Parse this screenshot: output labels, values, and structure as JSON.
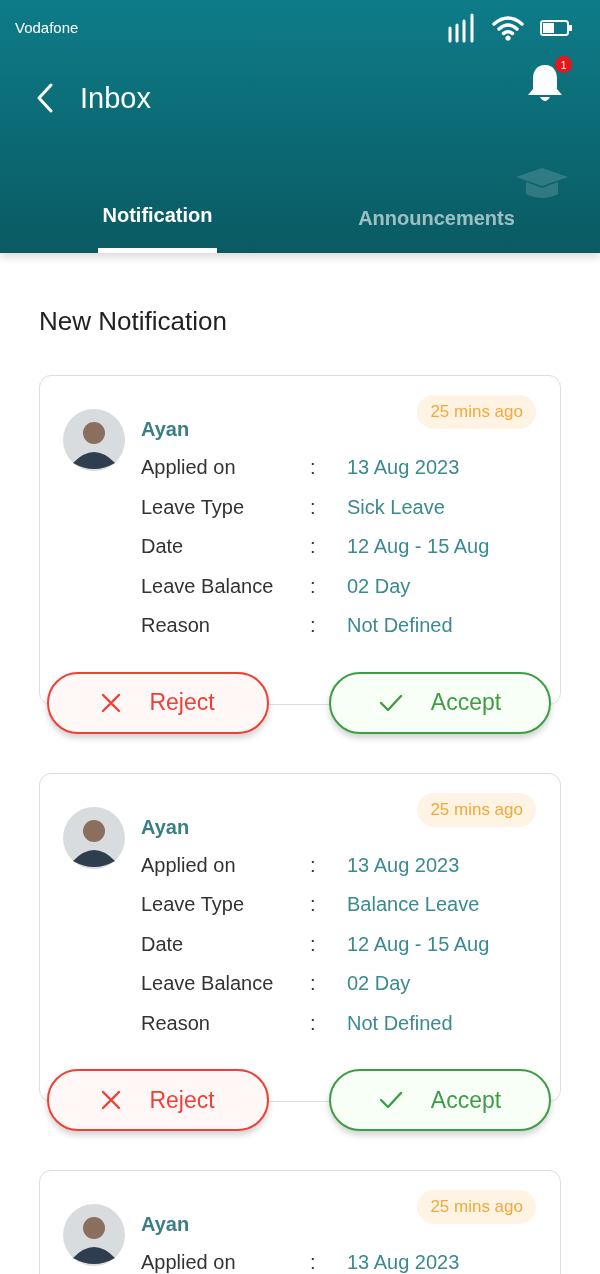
{
  "status_bar": {
    "carrier": "Vodafone"
  },
  "header": {
    "title": "Inbox",
    "notification_badge": "1"
  },
  "tabs": [
    {
      "label": "Notification",
      "selected": true
    },
    {
      "label": "Announcements",
      "selected": false
    }
  ],
  "section_title": "New Notification",
  "cards": [
    {
      "name": "Ayan",
      "time": "25 mins ago",
      "fields": [
        {
          "label": "Applied on",
          "sep": ":",
          "value": "13 Aug 2023"
        },
        {
          "label": "Leave Type",
          "sep": ":",
          "value": "Sick Leave"
        },
        {
          "label": "Date",
          "sep": ":",
          "value": "12 Aug - 15 Aug"
        },
        {
          "label": "Leave Balance",
          "sep": ":",
          "value": "02 Day"
        },
        {
          "label": "Reason",
          "sep": ":",
          "value": "Not Defined"
        }
      ],
      "actions": [
        {
          "kind": "reject",
          "label": "Reject"
        },
        {
          "kind": "accept",
          "label": "Accept"
        }
      ]
    },
    {
      "name": "Ayan",
      "time": "25 mins ago",
      "fields": [
        {
          "label": "Applied on",
          "sep": ":",
          "value": "13 Aug 2023"
        },
        {
          "label": "Leave Type",
          "sep": ":",
          "value": "Balance Leave"
        },
        {
          "label": "Date",
          "sep": ":",
          "value": "12 Aug - 15 Aug"
        },
        {
          "label": "Leave Balance",
          "sep": ":",
          "value": "02 Day"
        },
        {
          "label": "Reason",
          "sep": ":",
          "value": "Not Defined"
        }
      ],
      "actions": [
        {
          "kind": "reject",
          "label": "Reject"
        },
        {
          "kind": "accept",
          "label": "Accept"
        }
      ]
    },
    {
      "name": "Ayan",
      "time": "25 mins ago",
      "fields": [
        {
          "label": "Applied on",
          "sep": ":",
          "value": "13 Aug 2023"
        }
      ]
    }
  ]
}
